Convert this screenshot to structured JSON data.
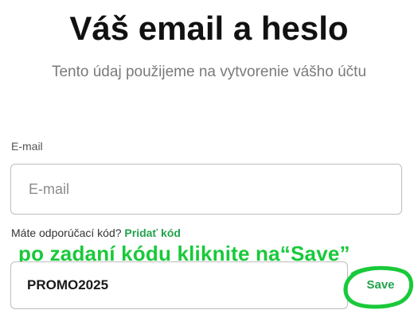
{
  "header": {
    "title": "Váš email a heslo",
    "subtitle": "Tento údaj použijeme na vytvorenie vášho účtu"
  },
  "email": {
    "label": "E-mail",
    "placeholder": "E-mail",
    "value": ""
  },
  "referral": {
    "question": "Máte odporúčací kód? ",
    "link_label": "Pridať kód"
  },
  "annotation": {
    "text": "po zadaní kódu kliknite na“Save”",
    "color": "#19c93a"
  },
  "promo": {
    "value": "PROMO2025"
  },
  "save_button": {
    "label": "Save"
  },
  "colors": {
    "accent": "#22a24b",
    "annotation_green": "#19c93a",
    "input_border": "#bdbdbd"
  }
}
